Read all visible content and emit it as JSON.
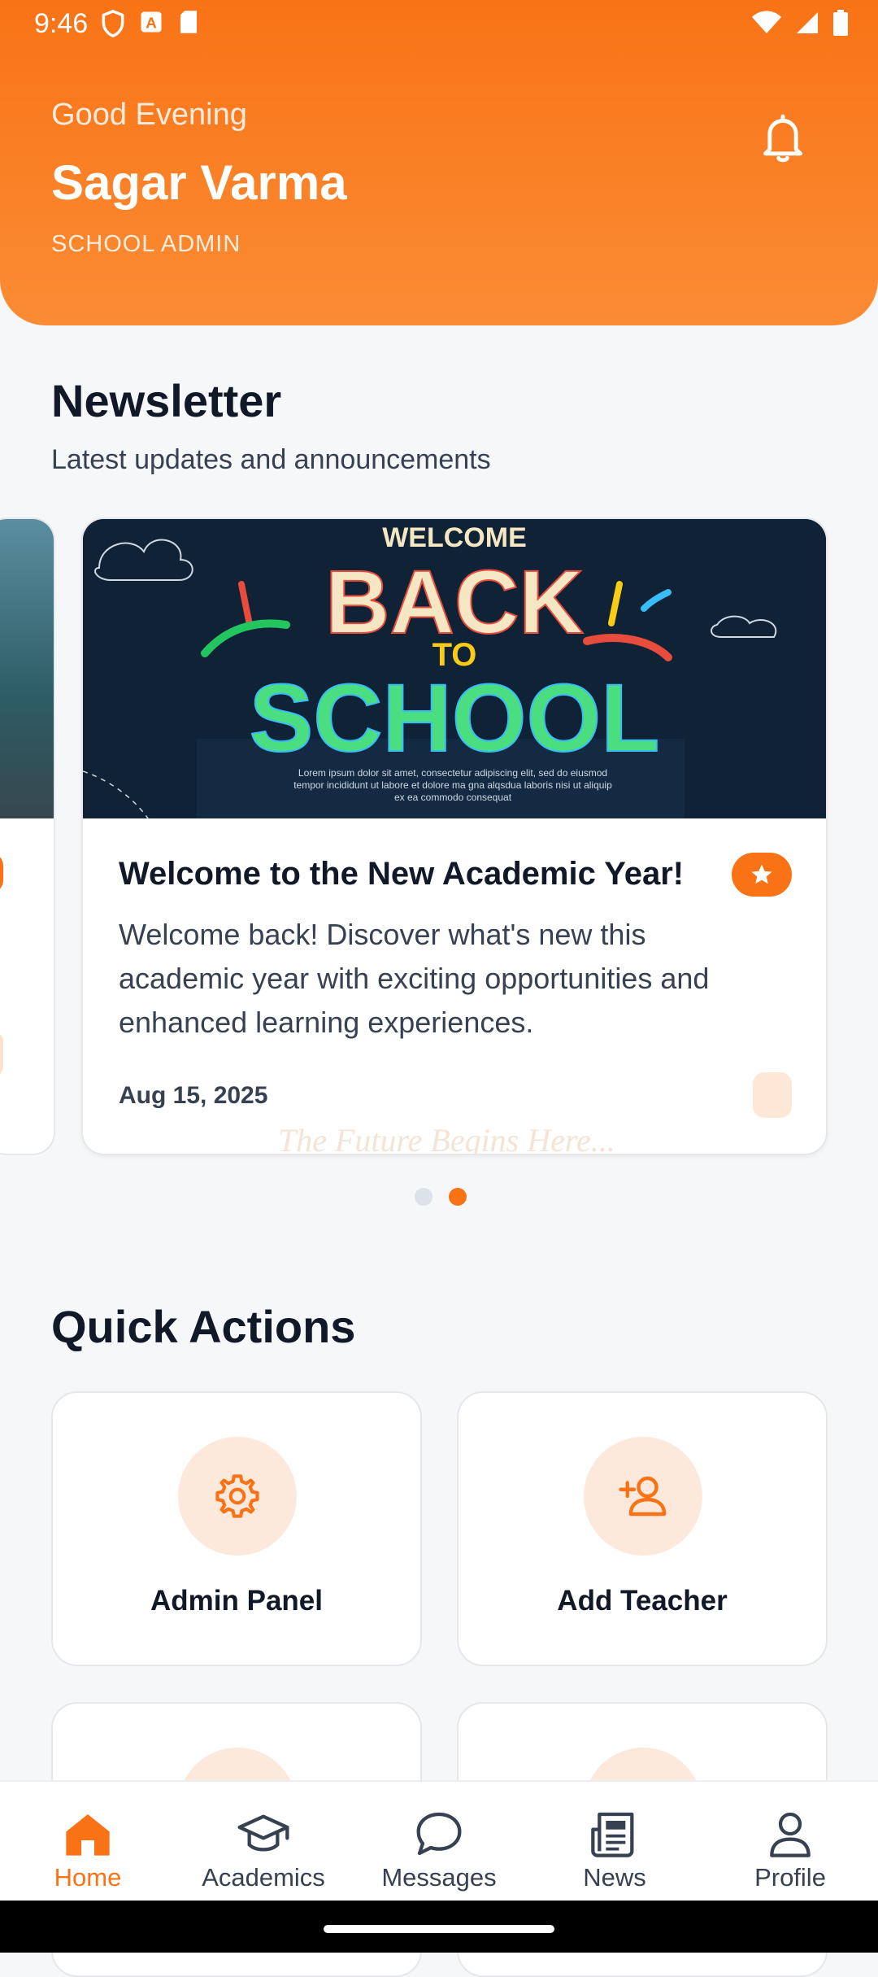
{
  "status_bar": {
    "time": "9:46"
  },
  "header": {
    "greeting": "Good Evening",
    "user_name": "Sagar Varma",
    "role": "SCHOOL ADMIN"
  },
  "newsletter": {
    "title": "Newsletter",
    "subtitle": "Latest updates and announcements",
    "card": {
      "image_heading_top": "WELCOME",
      "image_heading_main": "BACK",
      "image_heading_to": "TO",
      "image_heading_bottom": "SCHOOL",
      "image_caption": "Lorem ipsum dolor sit amet, consectetur adipiscing elit, sed do eiusmod tempor incididunt ut labore et dolore ma gna alqsdua laboris nisi ut aliquip ex ea commodo consequat",
      "title": "Welcome to the New Academic Year!",
      "description": "Welcome back! Discover what's new this academic year with exciting opportunities and enhanced learning experiences.",
      "date": "Aug 15, 2025",
      "watermark": "The Future Begins Here..."
    },
    "pagination": {
      "total": 2,
      "active_index": 1
    }
  },
  "quick_actions": {
    "title": "Quick Actions",
    "items": [
      {
        "label": "Admin Panel",
        "icon": "gear-icon"
      },
      {
        "label": "Add Teacher",
        "icon": "add-user-icon"
      }
    ]
  },
  "bottom_nav": {
    "items": [
      {
        "label": "Home",
        "icon": "home-icon",
        "active": true
      },
      {
        "label": "Academics",
        "icon": "graduation-cap-icon"
      },
      {
        "label": "Messages",
        "icon": "chat-icon"
      },
      {
        "label": "News",
        "icon": "newspaper-icon"
      },
      {
        "label": "Profile",
        "icon": "user-icon"
      }
    ]
  },
  "colors": {
    "accent": "#f97316",
    "accent_light": "#fde8dc",
    "text_dark": "#111827"
  }
}
